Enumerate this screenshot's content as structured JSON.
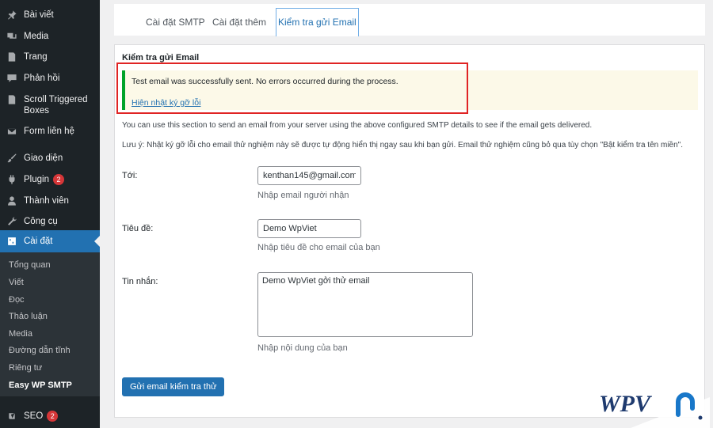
{
  "sidebar": {
    "items": [
      {
        "label": "Bài viết",
        "icon": "pin-icon"
      },
      {
        "label": "Media",
        "icon": "media-icon"
      },
      {
        "label": "Trang",
        "icon": "page-icon"
      },
      {
        "label": "Phản hồi",
        "icon": "comment-icon"
      },
      {
        "label": "Scroll Triggered Boxes",
        "icon": "page-icon"
      },
      {
        "label": "Form liên hệ",
        "icon": "mail-icon"
      },
      {
        "label": "Giao diện",
        "icon": "brush-icon"
      },
      {
        "label": "Plugin",
        "icon": "plugin-icon",
        "badge": "2"
      },
      {
        "label": "Thành viên",
        "icon": "user-icon"
      },
      {
        "label": "Công cụ",
        "icon": "wrench-icon"
      },
      {
        "label": "Cài đặt",
        "icon": "settings-icon"
      },
      {
        "label": "SEO",
        "icon": "yoast-icon",
        "badge": "2"
      }
    ],
    "submenu": [
      "Tổng quan",
      "Viết",
      "Đọc",
      "Thảo luận",
      "Media",
      "Đường dẫn tĩnh",
      "Riêng tư",
      "Easy WP SMTP"
    ]
  },
  "tabs": [
    "Cài đặt SMTP",
    "Cài đặt thêm",
    "Kiểm tra gửi Email"
  ],
  "panel": {
    "title": "Kiểm tra gửi Email",
    "notice_message": "Test email was successfully sent. No errors occurred during the process.",
    "notice_link": "Hiện nhật ký gỡ lỗi",
    "desc1": "You can use this section to send an email from your server using the above configured SMTP details to see if the email gets delivered.",
    "desc2_label": "Lưu ý:",
    "desc2": " Nhật ký gỡ lỗi cho email thử nghiệm này sẽ được tự động hiển thị ngay sau khi bạn gửi. Email thử nghiệm cũng bỏ qua tùy chọn \"Bật kiểm tra tên miền\"."
  },
  "form": {
    "to_label": "Tới:",
    "to_value": "kenthan145@gmail.com",
    "to_help": "Nhập email người nhận",
    "subject_label": "Tiêu đề:",
    "subject_value": "Demo WpViet",
    "subject_help": "Nhập tiêu đề cho email của bạn",
    "message_label": "Tin nhắn:",
    "message_value": "Demo WpViet gởi thử email",
    "message_help": "Nhập nội dung của bạn",
    "submit_label": "Gửi email kiểm tra thử"
  },
  "watermark": {
    "text": "WPV"
  },
  "colors": {
    "accent": "#2271b1",
    "sidebar_bg": "#1d2327",
    "success": "#00a32a",
    "highlight": "#e02424"
  }
}
